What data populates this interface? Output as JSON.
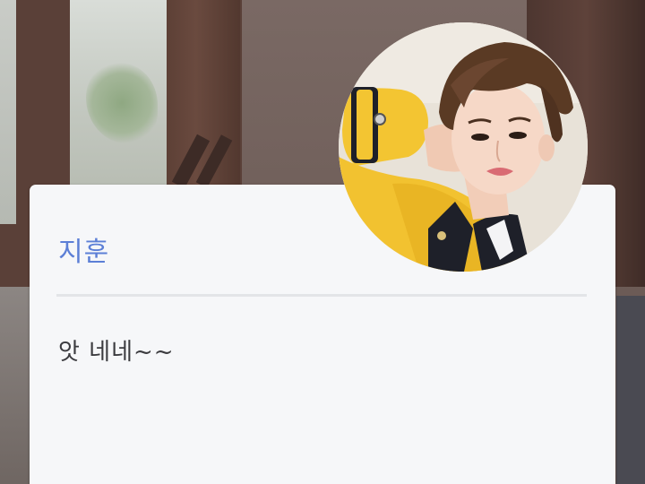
{
  "profile": {
    "name": "지훈",
    "message": "앗 네네~~"
  },
  "colors": {
    "name": "#5c7fd6",
    "message": "#3b3b3f",
    "card_bg": "#f6f7f9",
    "divider": "#e3e5e8"
  },
  "icons": {
    "avatar": "profile-photo"
  }
}
